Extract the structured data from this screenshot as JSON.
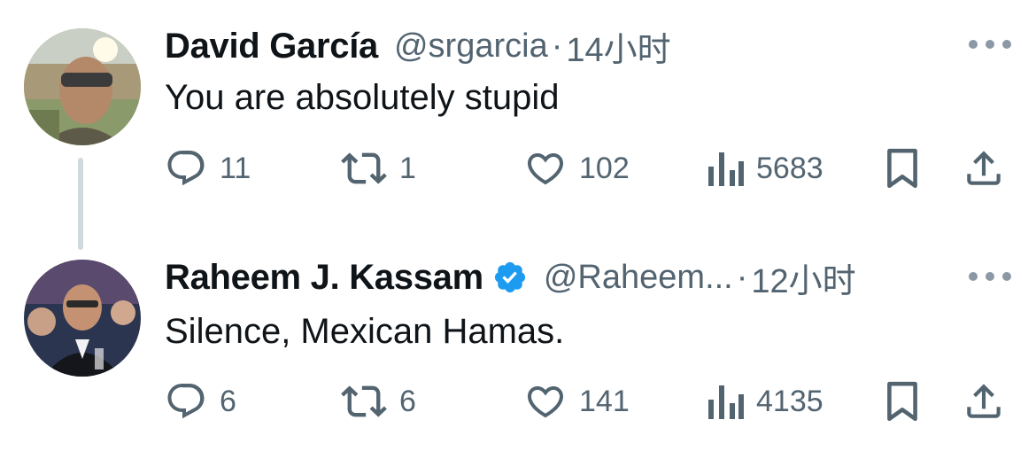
{
  "tweets": [
    {
      "name": "David García",
      "handle": "@srgarcia",
      "separator": "·",
      "time": "14小时",
      "verified": false,
      "text": "You are absolutely stupid",
      "replies": "11",
      "retweets": "1",
      "likes": "102",
      "views": "5683"
    },
    {
      "name": "Raheem J. Kassam",
      "handle": "@Raheem...",
      "separator": "·",
      "time": "12小时",
      "verified": true,
      "text": "Silence, Mexican Hamas.",
      "replies": "6",
      "retweets": "6",
      "likes": "141",
      "views": "4135"
    }
  ],
  "icons": {
    "reply": "speech-bubble-icon",
    "retweet": "retweet-arrows-icon",
    "like": "heart-icon",
    "views": "bar-chart-icon",
    "bookmark": "bookmark-icon",
    "share": "share-upload-icon",
    "more": "more-dots-icon",
    "verified": "verified-badge-icon"
  },
  "colors": {
    "text": "#0f1419",
    "secondary": "#536471",
    "verified": "#1d9bf0",
    "thread_line": "#cfd9de"
  }
}
